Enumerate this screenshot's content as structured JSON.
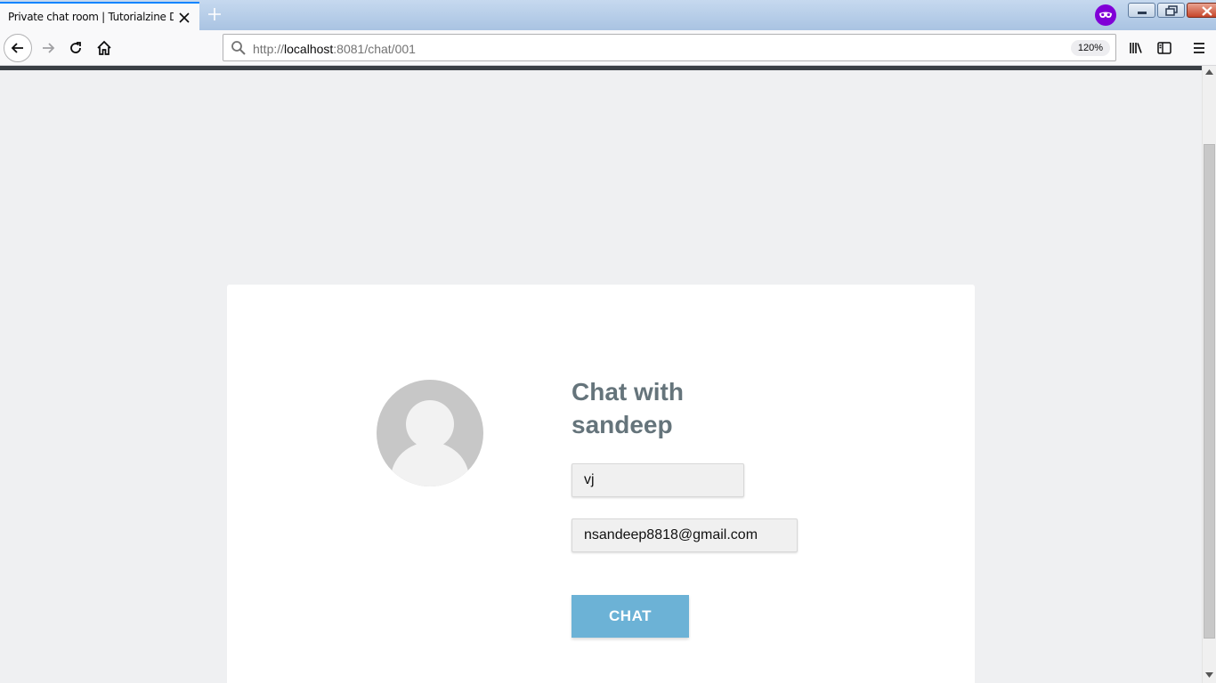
{
  "browser": {
    "tab_title": "Private chat room | Tutorialzine Demo",
    "url_prefix": "http://",
    "url_host": "localhost",
    "url_path": ":8081/chat/001",
    "zoom": "120%"
  },
  "chat": {
    "heading_line1": "Chat with",
    "heading_line2": "sandeep",
    "name_value": "vj",
    "email_value": "nsandeep8818@gmail.com",
    "button_label": "CHAT"
  },
  "colors": {
    "accent": "#6cb2d6",
    "heading": "#65747b",
    "private_badge": "#8000d7"
  }
}
